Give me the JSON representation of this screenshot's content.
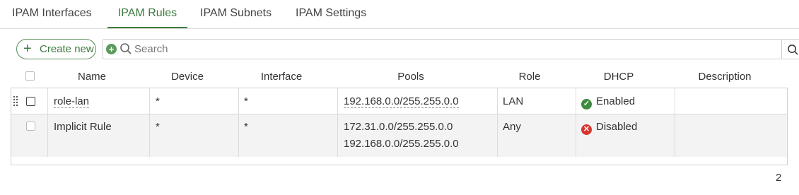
{
  "tabs": [
    {
      "label": "IPAM Interfaces",
      "active": false
    },
    {
      "label": "IPAM Rules",
      "active": true
    },
    {
      "label": "IPAM Subnets",
      "active": false
    },
    {
      "label": "IPAM Settings",
      "active": false
    }
  ],
  "toolbar": {
    "create_label": "Create new",
    "search_placeholder": "Search"
  },
  "table": {
    "columns": [
      "Name",
      "Device",
      "Interface",
      "Pools",
      "Role",
      "DHCP",
      "Description"
    ],
    "rows": [
      {
        "name": "role-lan",
        "device": "*",
        "interface": "*",
        "pools": [
          "192.168.0.0/255.255.0.0"
        ],
        "role": "LAN",
        "dhcp": "Enabled",
        "dhcp_status": "enabled",
        "description": ""
      },
      {
        "name": "Implicit Rule",
        "device": "*",
        "interface": "*",
        "pools": [
          "172.31.0.0/255.255.0.0",
          "192.168.0.0/255.255.0.0"
        ],
        "role": "Any",
        "dhcp": "Disabled",
        "dhcp_status": "disabled",
        "description": ""
      }
    ]
  },
  "footer": {
    "count": "2"
  },
  "colors": {
    "accent": "#3e7b3e",
    "enabled": "#3e8a3e",
    "disabled": "#d9352f"
  },
  "icons": [
    "plus-icon",
    "add-filter-icon",
    "search-icon",
    "drag-handle-icon",
    "check-circle-icon",
    "x-circle-icon"
  ]
}
